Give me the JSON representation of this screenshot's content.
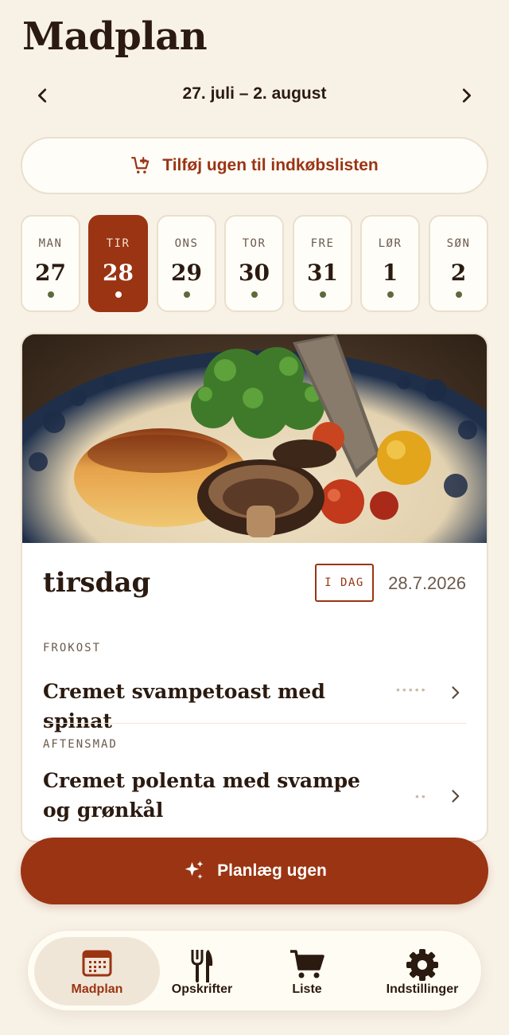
{
  "header": {
    "title": "Madplan"
  },
  "week": {
    "label": "27. juli – 2. august"
  },
  "actions": {
    "add_week_label": "Tilføj ugen til indkøbslisten",
    "plan_week_label": "Planlæg ugen"
  },
  "days": [
    {
      "name": "MAN",
      "num": "27",
      "active": false
    },
    {
      "name": "TIR",
      "num": "28",
      "active": true
    },
    {
      "name": "ONS",
      "num": "29",
      "active": false
    },
    {
      "name": "TOR",
      "num": "30",
      "active": false
    },
    {
      "name": "FRE",
      "num": "31",
      "active": false
    },
    {
      "name": "LØR",
      "num": "1",
      "active": false
    },
    {
      "name": "SØN",
      "num": "2",
      "active": false
    }
  ],
  "selected_day": {
    "title": "tirsdag",
    "badge": "I DAG",
    "date": "28.7.2026",
    "meals": [
      {
        "type": "FROKOST",
        "name": "Cremet svampetoast med spinat"
      },
      {
        "type": "AFTENSMAD",
        "name": "Cremet polenta med svampe og grønkål"
      }
    ]
  },
  "tabs": [
    {
      "label": "Madplan",
      "icon": "calendar-icon",
      "active": true
    },
    {
      "label": "Opskrifter",
      "icon": "fork-knife-icon",
      "active": false
    },
    {
      "label": "Liste",
      "icon": "cart-icon",
      "active": false
    },
    {
      "label": "Indstillinger",
      "icon": "gear-icon",
      "active": false
    }
  ],
  "colors": {
    "accent": "#9a3413",
    "background": "#f8f1e6",
    "dot": "#5d6b3b",
    "text": "#2b1a10"
  }
}
